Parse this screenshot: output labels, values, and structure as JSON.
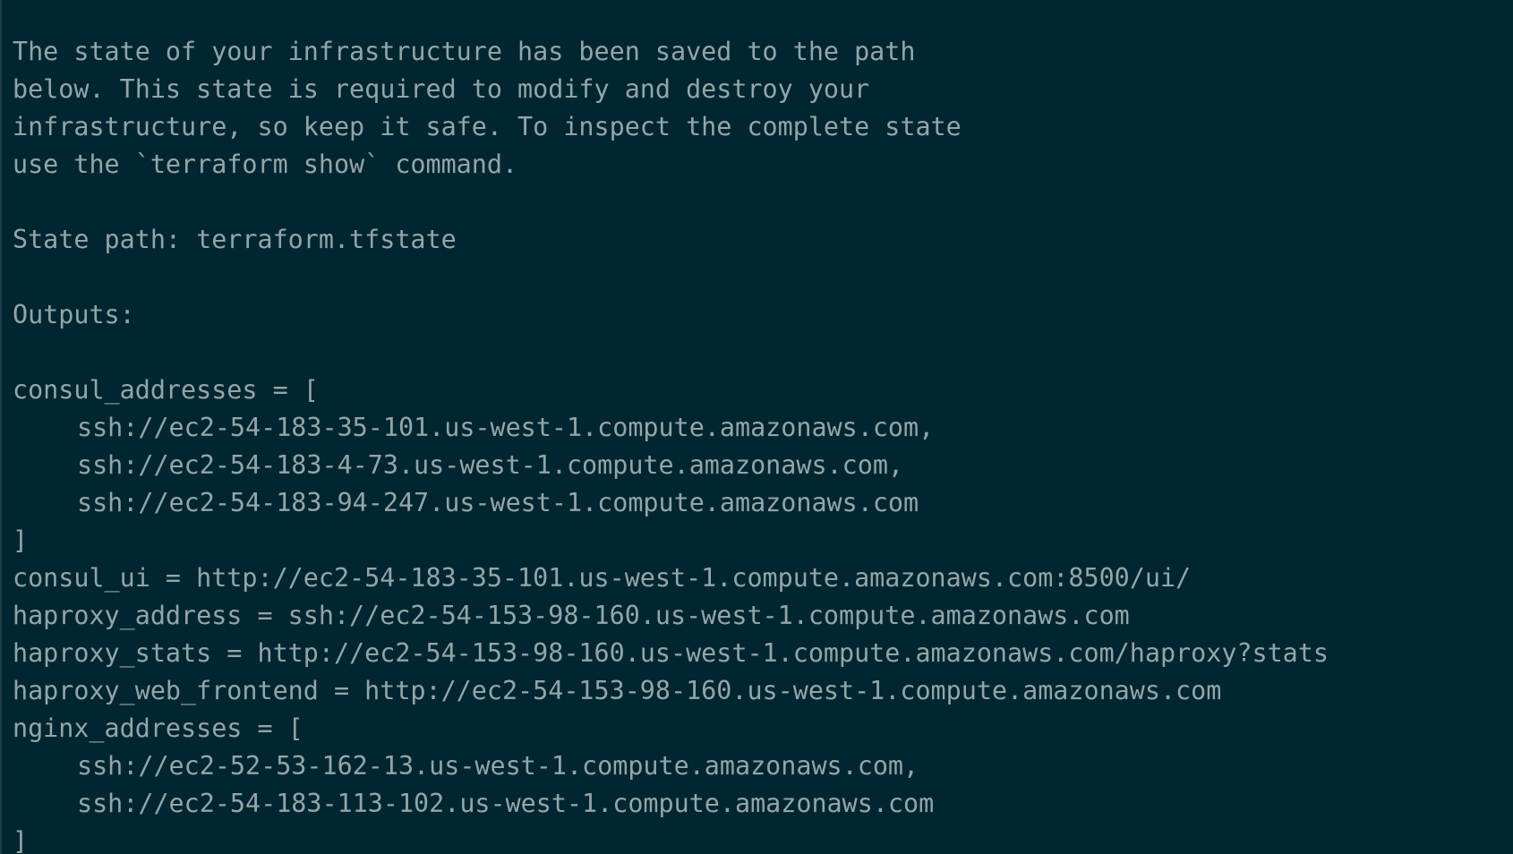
{
  "terminal": {
    "intro": [
      "The state of your infrastructure has been saved to the path",
      "below. This state is required to modify and destroy your",
      "infrastructure, so keep it safe. To inspect the complete state",
      "use the `terraform show` command."
    ],
    "state_path_line": "State path: terraform.tfstate",
    "outputs_heading": "Outputs:",
    "outputs": {
      "consul_addresses_open": "consul_addresses = [",
      "consul_addresses": [
        "ssh://ec2-54-183-35-101.us-west-1.compute.amazonaws.com,",
        "ssh://ec2-54-183-4-73.us-west-1.compute.amazonaws.com,",
        "ssh://ec2-54-183-94-247.us-west-1.compute.amazonaws.com"
      ],
      "consul_addresses_close": "]",
      "consul_ui": "consul_ui = http://ec2-54-183-35-101.us-west-1.compute.amazonaws.com:8500/ui/",
      "haproxy_address": "haproxy_address = ssh://ec2-54-153-98-160.us-west-1.compute.amazonaws.com",
      "haproxy_stats": "haproxy_stats = http://ec2-54-153-98-160.us-west-1.compute.amazonaws.com/haproxy?stats",
      "haproxy_web_frontend": "haproxy_web_frontend = http://ec2-54-153-98-160.us-west-1.compute.amazonaws.com",
      "nginx_addresses_open": "nginx_addresses = [",
      "nginx_addresses": [
        "ssh://ec2-52-53-162-13.us-west-1.compute.amazonaws.com,",
        "ssh://ec2-54-183-113-102.us-west-1.compute.amazonaws.com"
      ],
      "nginx_addresses_close": "]"
    }
  },
  "colors": {
    "background": "#002631",
    "text": "#94a5a7"
  }
}
